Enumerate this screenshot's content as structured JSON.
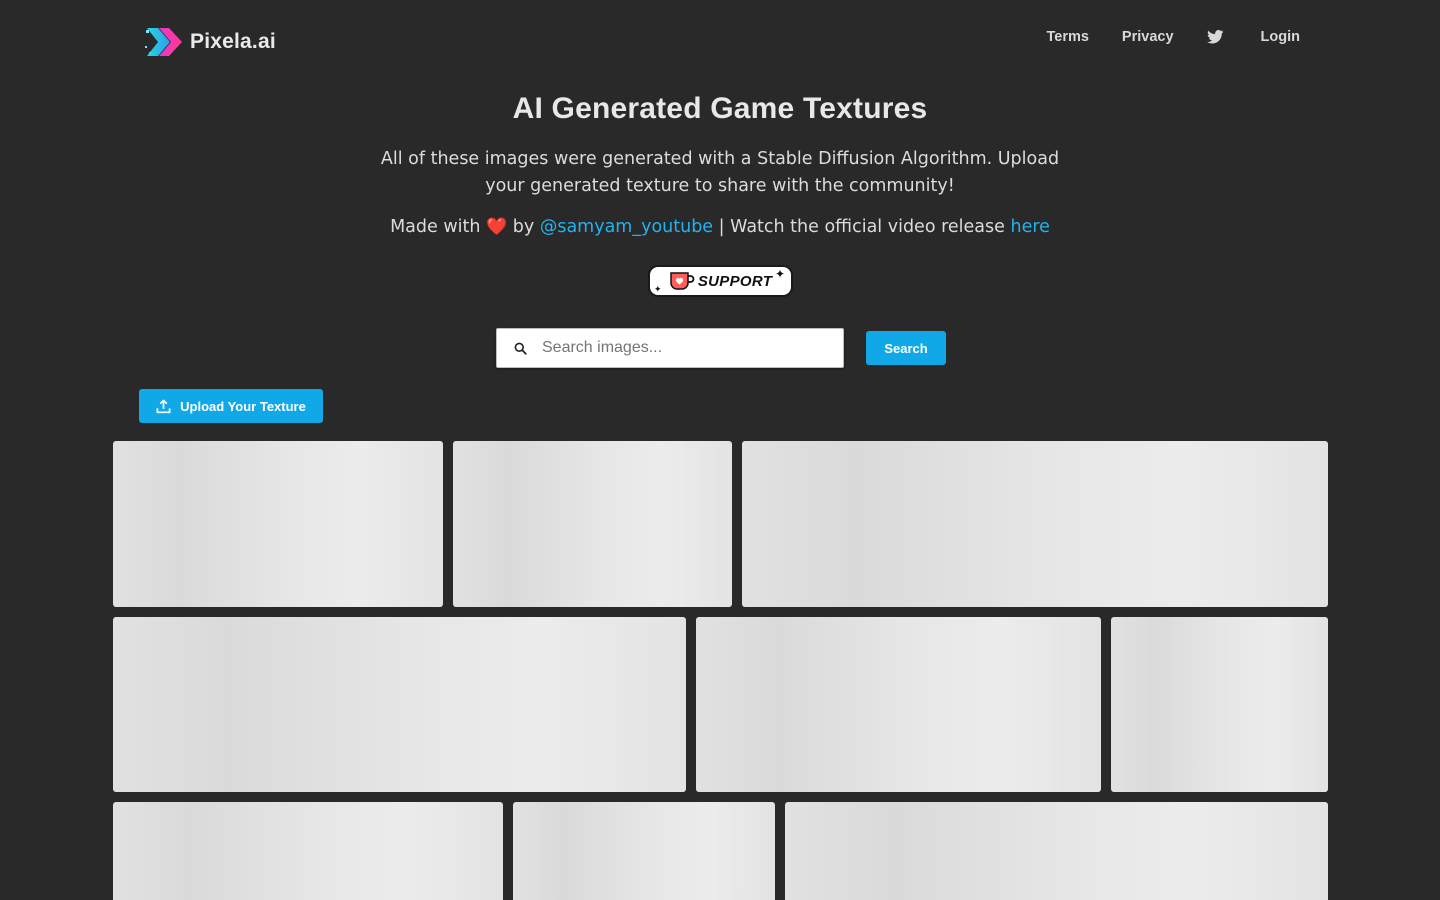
{
  "header": {
    "brand": "Pixela.ai",
    "nav": {
      "terms": "Terms",
      "privacy": "Privacy",
      "twitter_icon": "twitter-icon",
      "login": "Login"
    }
  },
  "hero": {
    "title": "AI Generated Game Textures",
    "description": "All of these images were generated with a Stable Diffusion Algorithm. Upload your generated texture to share with the community!",
    "credits": {
      "made_with": "Made with",
      "heart": "❤️",
      "by": "by",
      "author": "@samyam_youtube",
      "separator": "|",
      "watch_text": "Watch the official video release",
      "link_text": "here"
    },
    "support_label": "SUPPORT"
  },
  "search": {
    "placeholder": "Search images...",
    "button_label": "Search"
  },
  "upload": {
    "button_label": "Upload Your Texture"
  },
  "gallery": {
    "tile_count": 9
  },
  "colors": {
    "background": "#292929",
    "accent": "#11a8e8",
    "link": "#22b3ee",
    "tile_placeholder": "#e4e4e4"
  }
}
